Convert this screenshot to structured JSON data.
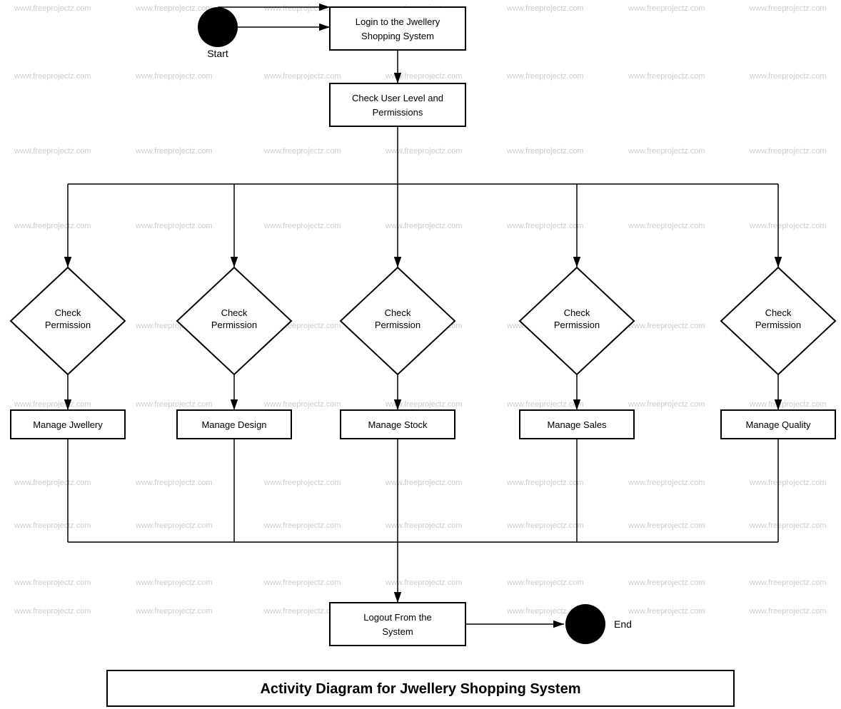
{
  "title": "Activity Diagram for Jwellery Shopping System",
  "watermark": "www.freeprojectz.com",
  "nodes": {
    "start_label": "Start",
    "end_label": "End",
    "login": "Login to the Jwellery\nShopping System",
    "check_user_level": "Check User Level and\nPermissions",
    "check_permission_1": "Check\nPermission",
    "check_permission_2": "Check\nPermission",
    "check_permission_3": "Check\nPermission",
    "check_permission_4": "Check\nPermission",
    "check_permission_5": "Check\nPermission",
    "manage_jwellery": "Manage Jwellery",
    "manage_design": "Manage Design",
    "manage_stock": "Manage Stock",
    "manage_sales": "Manage Sales",
    "manage_quality": "Manage Quality",
    "logout": "Logout From the\nSystem"
  }
}
